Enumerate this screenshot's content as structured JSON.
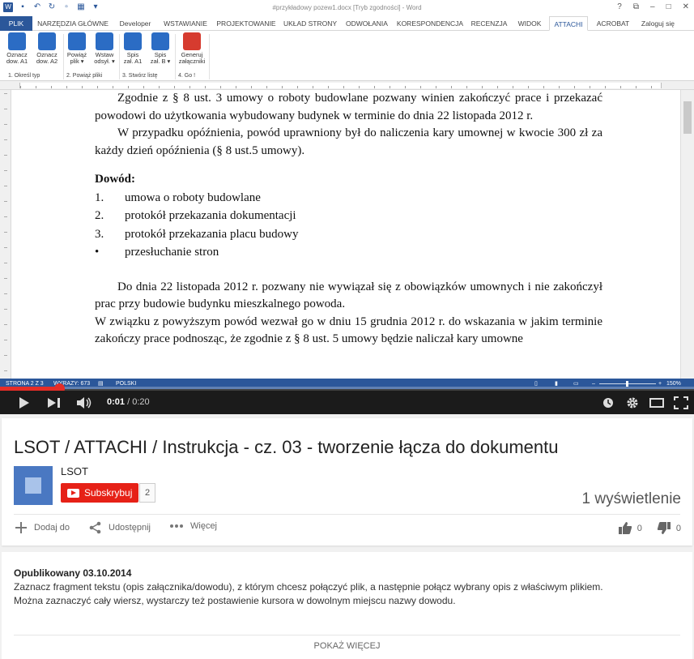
{
  "word": {
    "doc_title": "#przykładowy pozew1.docx [Tryb zgodności] - Word",
    "tabs": [
      "PLIK",
      "NARZĘDZIA GŁÓWNE",
      "Developer",
      "WSTAWIANIE",
      "PROJEKTOWANIE",
      "UKŁAD STRONY",
      "ODWOŁANIA",
      "KORESPONDENCJA",
      "RECENZJA",
      "WIDOK",
      "ATTACHI",
      "ACROBAT"
    ],
    "login": "Zaloguj się",
    "ribbon_buttons": [
      {
        "l1": "Oznacz",
        "l2": "dow. A1"
      },
      {
        "l1": "Oznacz",
        "l2": "dow. A2"
      },
      {
        "l1": "Powiąż",
        "l2": "plik ▾"
      },
      {
        "l1": "Wstaw",
        "l2": "odsył. ▾"
      },
      {
        "l1": "Spis",
        "l2": "zał. A1"
      },
      {
        "l1": "Spis",
        "l2": "zał. B ▾"
      },
      {
        "l1": "Generuj",
        "l2": "załączniki"
      }
    ],
    "groups": [
      "1. Określ typ",
      "2. Powiąż pliki",
      "3. Stwórz listę",
      "4. Go !"
    ],
    "doc": {
      "p1": "Zgodnie z § 8 ust. 3 umowy o roboty budowlane pozwany winien zakończyć prace i przekazać powodowi do użytkowania wybudowany budynek w terminie do dnia 22 listopada 2012 r.",
      "p2": "W przypadku opóźnienia, powód uprawniony był do naliczenia kary umownej w kwocie 300 zł za każdy dzień opóźnienia (§ 8 ust.5 umowy).",
      "evidence_heading": "Dowód:",
      "list": [
        {
          "num": "1.",
          "text": "umowa o roboty budowlane"
        },
        {
          "num": "2.",
          "text": "protokół przekazania dokumentacji"
        },
        {
          "num": "3.",
          "text": "protokół przekazania placu budowy"
        },
        {
          "num": "•",
          "text": "przesłuchanie stron"
        }
      ],
      "p3": "Do dnia 22 listopada 2012 r. pozwany nie wywiązał się z obowiązków umownych i nie zakończył prac przy budowie budynku mieszkalnego powoda.",
      "p4": "W związku z powyższym powód wezwał go w dniu 15 grudnia 2012 r. do wskazania w jakim terminie zakończy prace podnosząc, że zgodnie z § 8 ust. 5 umowy będzie naliczał kary umowne"
    },
    "status": {
      "page": "STRONA 2 Z 3",
      "words": "WYRAZY: 673",
      "lang": "POLSKI",
      "zoom": "150%"
    }
  },
  "player": {
    "current_time": "0:01",
    "duration": "0:20",
    "progress_fraction": 0.085
  },
  "video": {
    "title": "LSOT / ATTACHI / Instrukcja - cz. 03 - tworzenie łącza do dokumentu",
    "channel": "LSOT",
    "subscribe_label": "Subskrybuj",
    "subscriber_count": "2",
    "views": "1 wyświetlenie",
    "actions": {
      "add": "Dodaj do",
      "share": "Udostępnij",
      "more": "Więcej"
    },
    "likes": "0",
    "dislikes": "0"
  },
  "description": {
    "published": "Opublikowany 03.10.2014",
    "line1": "Zaznacz fragment tekstu (opis załącznika/dowodu), z którym chcesz połączyć plik, a następnie połącz wybrany opis z właściwym plikiem.",
    "line2": "Można zaznaczyć cały wiersz, wystarczy też postawienie kursora w dowolnym miejscu nazwy dowodu.",
    "show_more": "POKAŻ WIĘCEJ"
  },
  "colors": {
    "word_blue": "#2b579a",
    "yt_red": "#e62117",
    "progress_red": "#e52d27"
  }
}
